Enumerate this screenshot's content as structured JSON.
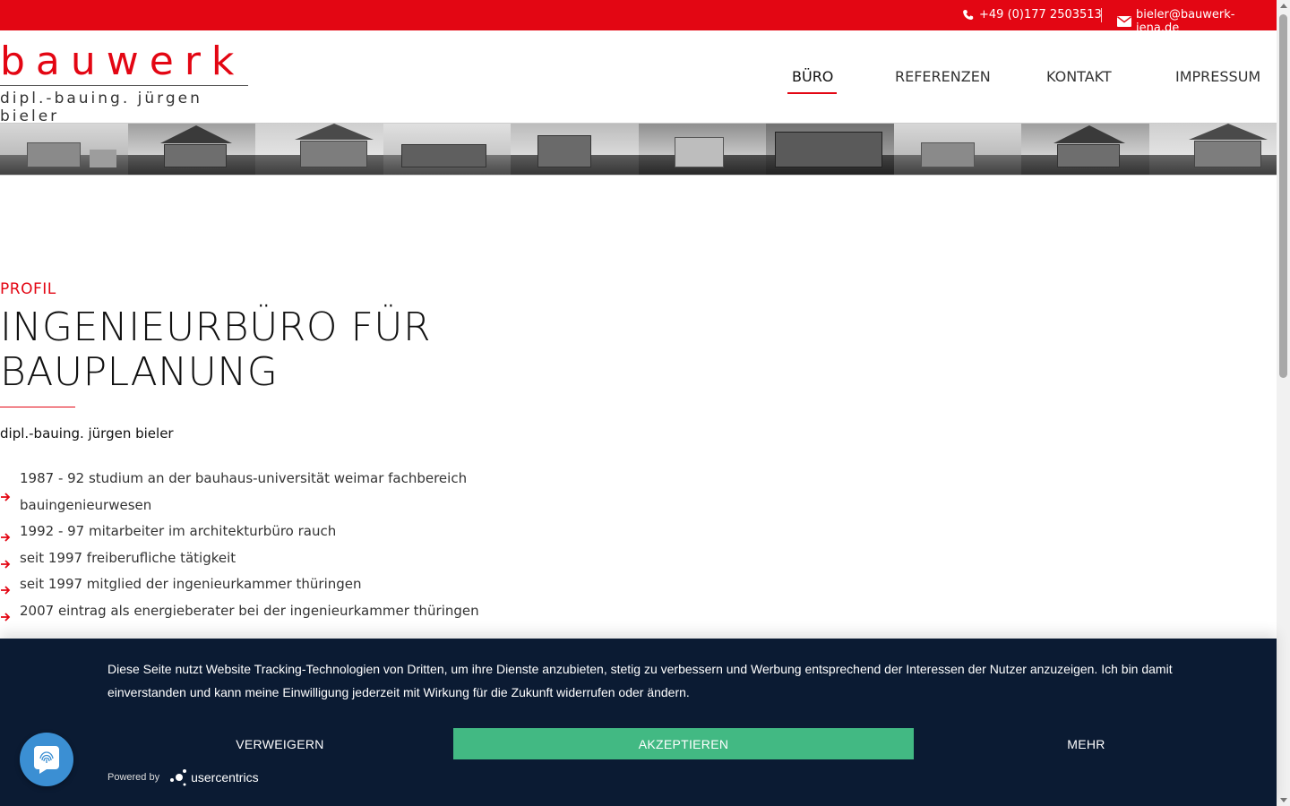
{
  "topbar": {
    "phone": "+49 (0)177 2503513",
    "email": "bieler@bauwerk-jena.de",
    "phone_icon": "phone-icon",
    "email_icon": "envelope-icon",
    "background": "#e30613"
  },
  "logo": {
    "word": "bauwerk",
    "sub": "dipl.-bauing. jürgen bieler",
    "color": "#e30613"
  },
  "nav": {
    "items": [
      {
        "label": "BÜRO",
        "active": true
      },
      {
        "label": "REFERENZEN",
        "active": false
      },
      {
        "label": "KONTAKT",
        "active": false
      },
      {
        "label": "IMPRESSUM",
        "active": false
      }
    ]
  },
  "content": {
    "eyebrow": "PROFIL",
    "headline_line1": "INGENIEURBÜRO FÜR",
    "headline_line2": "BAUPLANUNG",
    "name": "dipl.-bauing. jürgen bieler",
    "list": [
      "1987 - 92 studium an der bauhaus-universität weimar fachbereich bauingenieurwesen",
      "1992 - 97 mitarbeiter im architekturbüro rauch",
      "seit 1997 freiberufliche tätigkeit",
      "seit 1997 mitglied der ingenieurkammer thüringen",
      "2007 eintrag als energieberater bei der ingenieurkammer thüringen"
    ]
  },
  "cookie": {
    "text": "Diese Seite nutzt Website Tracking-Technologien von Dritten, um ihre Dienste anzubieten, stetig zu verbessern und Werbung entsprechend der Interessen der Nutzer anzuzeigen. Ich bin damit einverstanden und kann meine Einwilligung jederzeit mit Wirkung für die Zukunft widerrufen oder ändern.",
    "deny": "VERWEIGERN",
    "accept": "AKZEPTIEREN",
    "more": "MEHR",
    "powered_by": "Powered by",
    "brand": "usercentrics",
    "background": "#0b1b33",
    "accept_color": "#42b983"
  },
  "fab": {
    "icon": "fingerprint-icon"
  }
}
